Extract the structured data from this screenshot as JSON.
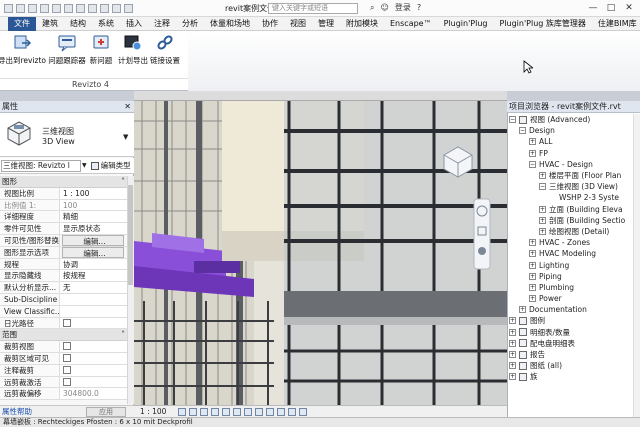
{
  "titlebar": {
    "title": "revit案例文件.rvt",
    "search_placeholder": "键入关键字或短语",
    "login": "登录",
    "minimize": "—",
    "maximize": "□",
    "close": "✕"
  },
  "menu": {
    "file": "文件",
    "tabs": [
      "建筑",
      "结构",
      "系统",
      "插入",
      "注释",
      "分析",
      "体量和场地",
      "协作",
      "视图",
      "管理",
      "附加模块",
      "Enscape™",
      "Plugin'Plug",
      "Plugin'Plug 族库管理器",
      "住建BIM库"
    ]
  },
  "ribbon": {
    "buttons": [
      {
        "label": "导出到revizto",
        "icon": "export-revizto-icon"
      },
      {
        "label": "问题跟踪器",
        "icon": "issue-tracker-icon"
      },
      {
        "label": "新问题",
        "icon": "new-issue-icon"
      },
      {
        "label": "计划导出",
        "icon": "schedule-export-icon"
      },
      {
        "label": "链接设置",
        "icon": "link-settings-icon"
      }
    ],
    "panel_title": "Revizto 4"
  },
  "properties": {
    "title": "属性",
    "close": "✕",
    "type_line1": "三维视图",
    "type_line2": "3D View",
    "type_selector": "三维视图: Revizto l",
    "edit_type": "编辑类型",
    "section_graphics": "图形",
    "rows_graphics": [
      {
        "k": "视图比例",
        "v": "1 : 100"
      },
      {
        "k": "比例值 1:",
        "v": "100"
      },
      {
        "k": "详细程度",
        "v": "精细"
      },
      {
        "k": "零件可见性",
        "v": "显示原状态"
      },
      {
        "k": "可见性/图形替换",
        "v": "编辑..."
      },
      {
        "k": "图形显示选项",
        "v": "编辑..."
      },
      {
        "k": "规程",
        "v": "协调"
      },
      {
        "k": "显示隐藏线",
        "v": "按规程"
      },
      {
        "k": "默认分析显示...",
        "v": "无"
      },
      {
        "k": "Sub-Discipline",
        "v": ""
      },
      {
        "k": "View Classific...",
        "v": ""
      },
      {
        "k": "日光路径",
        "v": ""
      }
    ],
    "section_extents": "范围",
    "rows_extents": [
      {
        "k": "裁剪视图",
        "v": ""
      },
      {
        "k": "裁剪区域可见",
        "v": ""
      },
      {
        "k": "注释裁剪",
        "v": ""
      },
      {
        "k": "远剪裁激活",
        "v": ""
      },
      {
        "k": "远剪裁偏移",
        "v": "304800.0"
      }
    ],
    "help_link": "属性帮助",
    "apply": "应用"
  },
  "viewbar": {
    "scale": "1 : 100"
  },
  "browser": {
    "title": "项目浏览器 - revit案例文件.rvt",
    "items": [
      {
        "label": "视图 (Advanced)",
        "level": 0,
        "exp": "−",
        "icon": true
      },
      {
        "label": "Design",
        "level": 1,
        "exp": "−"
      },
      {
        "label": "ALL",
        "level": 2,
        "exp": "+"
      },
      {
        "label": "FP",
        "level": 2,
        "exp": "+"
      },
      {
        "label": "HVAC - Design",
        "level": 2,
        "exp": "−"
      },
      {
        "label": "楼层平面 (Floor Plan",
        "level": 3,
        "exp": "+"
      },
      {
        "label": "三维视图 (3D View)",
        "level": 3,
        "exp": "−"
      },
      {
        "label": "WSHP 2-3 Syste",
        "level": 4,
        "exp": ""
      },
      {
        "label": "立面 (Building Eleva",
        "level": 3,
        "exp": "+"
      },
      {
        "label": "剖面 (Building Sectio",
        "level": 3,
        "exp": "+"
      },
      {
        "label": "绘图视图 (Detail)",
        "level": 3,
        "exp": "+"
      },
      {
        "label": "HVAC - Zones",
        "level": 2,
        "exp": "+"
      },
      {
        "label": "HVAC Modeling",
        "level": 2,
        "exp": "+"
      },
      {
        "label": "Lighting",
        "level": 2,
        "exp": "+"
      },
      {
        "label": "Piping",
        "level": 2,
        "exp": "+"
      },
      {
        "label": "Plumbing",
        "level": 2,
        "exp": "+"
      },
      {
        "label": "Power",
        "level": 2,
        "exp": "+"
      },
      {
        "label": "Documentation",
        "level": 1,
        "exp": "+"
      },
      {
        "label": "图例",
        "level": 0,
        "exp": "+",
        "icon": true
      },
      {
        "label": "明细表/数量",
        "level": 0,
        "exp": "+",
        "icon": true
      },
      {
        "label": "配电盘明细表",
        "level": 0,
        "exp": "+",
        "icon": true
      },
      {
        "label": "报告",
        "level": 0,
        "exp": "+",
        "icon": true
      },
      {
        "label": "图纸 (all)",
        "level": 0,
        "exp": "+",
        "icon": true
      },
      {
        "label": "族",
        "level": 0,
        "exp": "+",
        "icon": true
      }
    ]
  },
  "status": {
    "text": "幕墙嵌板 : Rechteckiges Pfosten : 6 x 10 mit Deckprofil"
  },
  "colors": {
    "accent": "#cde0f7",
    "duct_purple": "#8a4fd8",
    "file_tab": "#2b5797"
  }
}
